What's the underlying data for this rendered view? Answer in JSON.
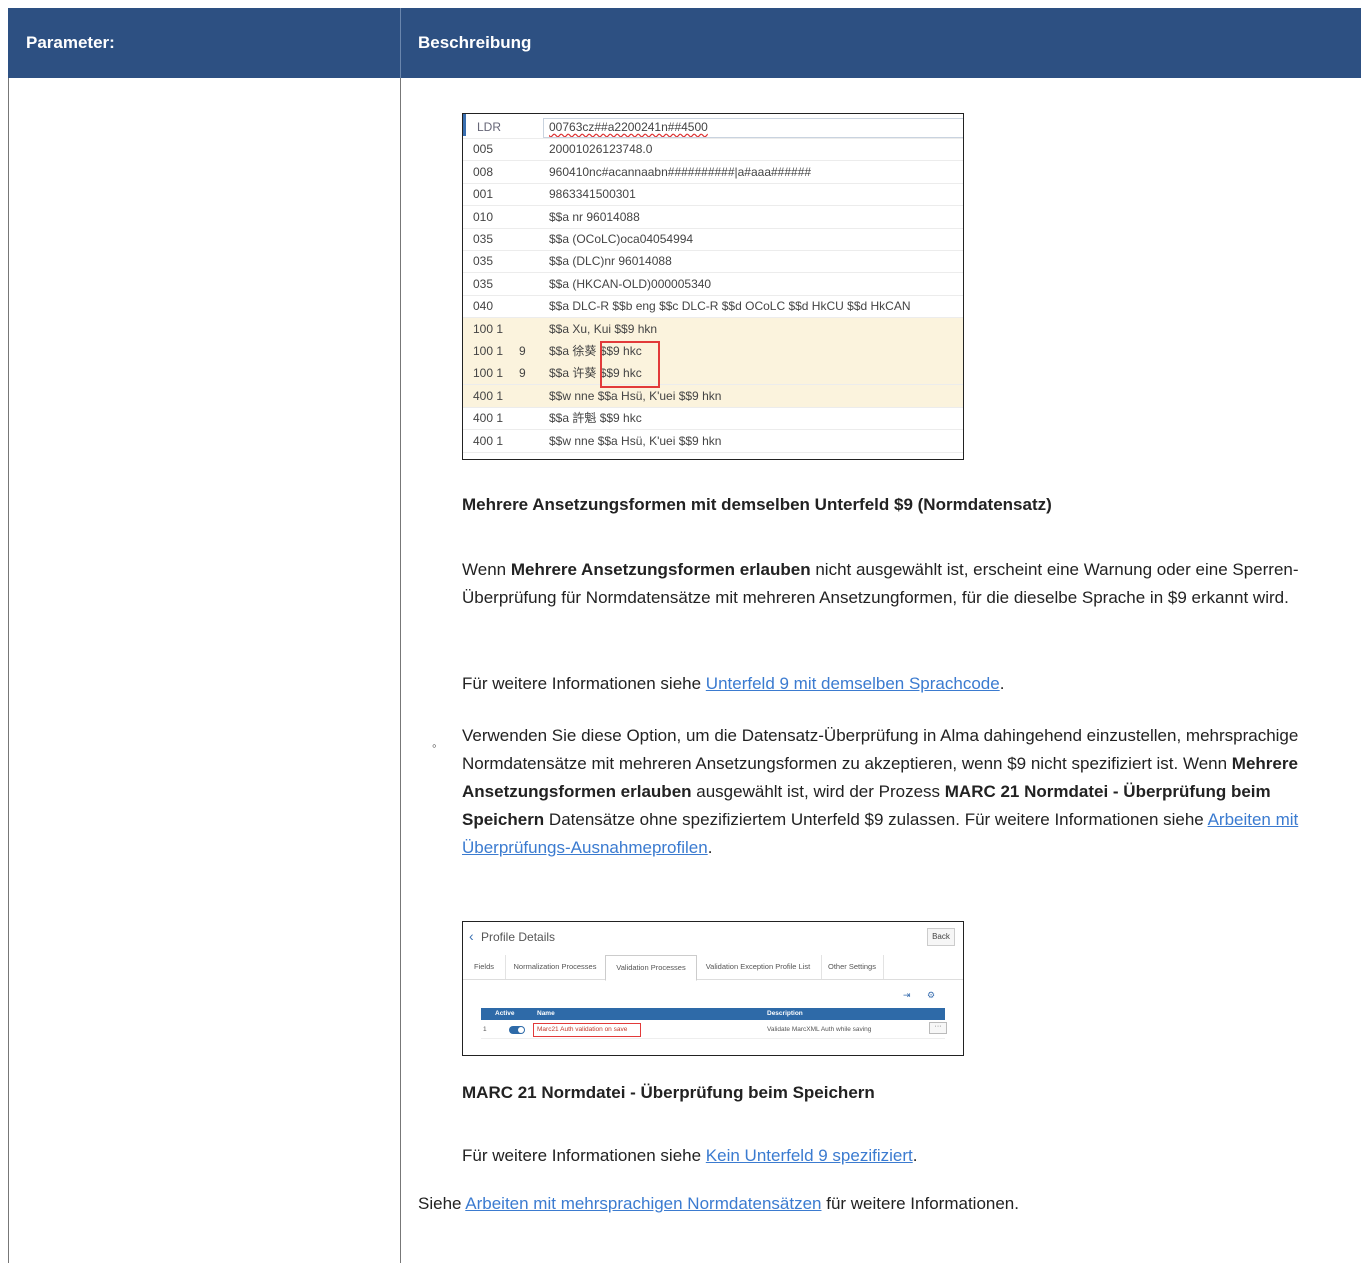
{
  "table": {
    "header_param": "Parameter:",
    "header_desc": "Beschreibung"
  },
  "marc": {
    "rows": [
      {
        "tag": "LDR",
        "ind": "",
        "value": "00763cz##a2200241n##4500"
      },
      {
        "tag": "005",
        "ind": "",
        "value": "20001026123748.0"
      },
      {
        "tag": "008",
        "ind": "",
        "value": "960410nc#acannaabn##########|a#aaa######"
      },
      {
        "tag": "001",
        "ind": "",
        "value": "9863341500301"
      },
      {
        "tag": "010",
        "ind": "",
        "value": "$$a nr 96014088"
      },
      {
        "tag": "035",
        "ind": "",
        "value": "$$a (OCoLC)oca04054994"
      },
      {
        "tag": "035",
        "ind": "",
        "value": "$$a (DLC)nr 96014088"
      },
      {
        "tag": "035",
        "ind": "",
        "value": "$$a (HKCAN-OLD)000005340"
      },
      {
        "tag": "040",
        "ind": "",
        "value": "$$a DLC-R $$b eng $$c DLC-R $$d OCoLC $$d HkCU $$d HkCAN"
      },
      {
        "tag": "100 1",
        "ind": "",
        "value": "$$a Xu, Kui $$9 hkn"
      },
      {
        "tag": "100 1",
        "ind": "9",
        "value": "$$a 徐葵 $$9 hkc"
      },
      {
        "tag": "100 1",
        "ind": "9",
        "value": "$$a 许葵 $$9 hkc"
      },
      {
        "tag": "400 1",
        "ind": "",
        "value": "$$w nne $$a Hsü, K'uei $$9 hkn"
      },
      {
        "tag": "400 1",
        "ind": "",
        "value": "$$a 許魁 $$9 hkc"
      },
      {
        "tag": "400 1",
        "ind": "",
        "value": "$$w nne $$a Hsü, K'uei $$9 hkn"
      }
    ]
  },
  "caption1": "Mehrere Ansetzungsformen mit demselben Unterfeld $9 (Normdatensatz)",
  "para1": {
    "pre": "Wenn ",
    "bold": "Mehrere Ansetzungsformen erlauben",
    "post": " nicht ausgewählt ist, erscheint eine Warnung oder eine Sperren-Überprüfung für Normdatensätze mit mehreren Ansetzungformen, für die dieselbe Sprache in $9 erkannt wird."
  },
  "para2": {
    "pre": "Für weitere Informationen siehe ",
    "link": "Unterfeld 9 mit demselben Sprachcode",
    "post": "."
  },
  "bullet": {
    "marker": "◦",
    "text1": "Verwenden Sie diese Option, um die Datensatz-Überprüfung in Alma dahingehend einzustellen, mehrsprachige Normdatensätze mit mehreren Ansetzungsformen zu akzeptieren, wenn $9 nicht spezifiziert ist. Wenn ",
    "bold1": "Mehrere Ansetzungsformen erlauben",
    "text2": " ausgewählt ist, wird der Prozess ",
    "bold2": "MARC 21 Normdatei - Überprüfung beim Speichern",
    "text3": " Datensätze ohne spezifiziertem Unterfeld $9 zulassen. Für weitere Informationen siehe ",
    "link": "Arbeiten mit Überprüfungs-Ausnahmeprofilen",
    "text4": "."
  },
  "profile": {
    "title": "Profile Details",
    "back": "Back",
    "tabs": [
      "Fields",
      "Normalization Processes",
      "Validation Processes",
      "Validation Exception Profile List",
      "Other Settings"
    ],
    "active_tab": "Validation Processes",
    "col_active": "Active",
    "col_name": "Name",
    "col_description": "Description",
    "row_num": "1",
    "row_name": "Marc21 Auth validation on save",
    "row_description": "Validate MarcXML Auth while saving",
    "more": "···"
  },
  "caption2": "MARC 21 Normdatei - Überprüfung beim Speichern",
  "para3": {
    "pre": "Für weitere Informationen siehe ",
    "link": "Kein Unterfeld 9 spezifiziert",
    "post": "."
  },
  "para4": {
    "pre": "Siehe ",
    "link": "Arbeiten mit mehrsprachigen Normdatensätzen",
    "post": " für weitere Informationen."
  },
  "colors": {
    "header_bg": "#2d5082",
    "link": "#3b7bd0",
    "highlight": "#fbf3dd",
    "red_box": "#e23a3a"
  }
}
